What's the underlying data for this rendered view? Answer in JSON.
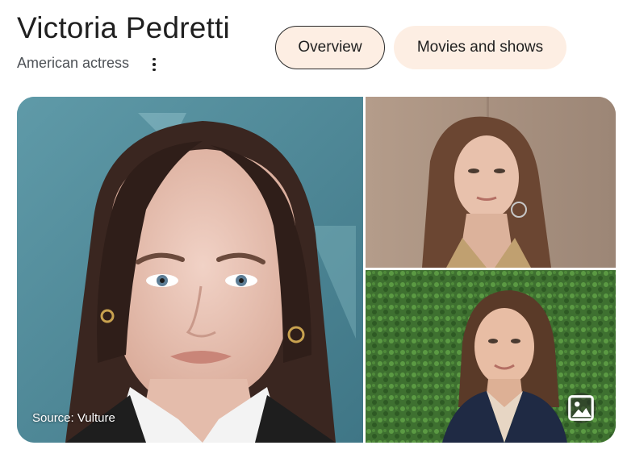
{
  "entity": {
    "name": "Victoria Pedretti",
    "description": "American actress"
  },
  "tabs": [
    {
      "label": "Overview",
      "selected": true
    },
    {
      "label": "Movies and shows",
      "selected": false
    }
  ],
  "gallery": {
    "main_source": "Source: Vulture",
    "images": [
      {
        "icon": "portrait-photo-1"
      },
      {
        "icon": "portrait-photo-2"
      },
      {
        "icon": "portrait-photo-3"
      }
    ],
    "images_button_icon": "image-gallery-icon"
  },
  "colors": {
    "tab_background": "#fdeee3",
    "selected_tab_border": "#2a2a2a",
    "text_primary": "#1f1f1f",
    "text_secondary": "#4d5156"
  }
}
